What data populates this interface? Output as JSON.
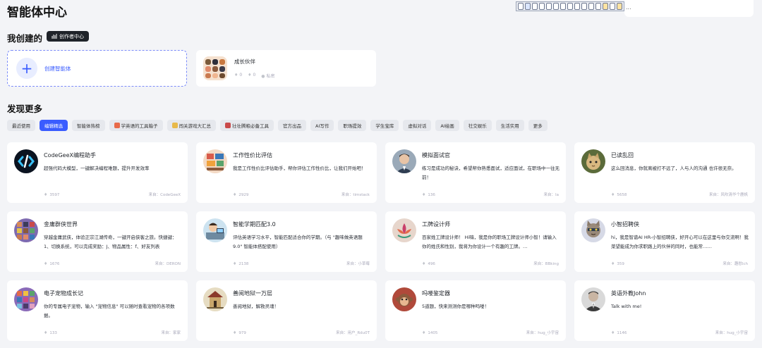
{
  "page_title": "智能体中心",
  "toolbar_ellipsis": "...",
  "created_section": {
    "title": "我创建的",
    "creator_badge": "创作者中心",
    "create_label": "创建智能体",
    "my_agent": {
      "name": "成长伙伴",
      "likes": "0",
      "favorites": "0",
      "status": "私密"
    }
  },
  "discover_section": {
    "title": "发现更多",
    "tabs": [
      {
        "label": "最近使用",
        "active": false,
        "emoji_color": ""
      },
      {
        "label": "编辑精选",
        "active": true,
        "emoji_color": ""
      },
      {
        "label": "智能体热榜",
        "active": false,
        "emoji_color": ""
      },
      {
        "label": "学英语的工具箱子",
        "active": false,
        "emoji_color": "#e86a4a"
      },
      {
        "label": "闯关游戏大汇总",
        "active": false,
        "emoji_color": "#e8b94a"
      },
      {
        "label": "壮壮腾粮必备工具",
        "active": false,
        "emoji_color": "#c94a4a"
      },
      {
        "label": "官方出品",
        "active": false,
        "emoji_color": ""
      },
      {
        "label": "AI写作",
        "active": false,
        "emoji_color": ""
      },
      {
        "label": "职场提效",
        "active": false,
        "emoji_color": ""
      },
      {
        "label": "学生宝库",
        "active": false,
        "emoji_color": ""
      },
      {
        "label": "虚拟对话",
        "active": false,
        "emoji_color": ""
      },
      {
        "label": "AI绘画",
        "active": false,
        "emoji_color": ""
      },
      {
        "label": "社交娱乐",
        "active": false,
        "emoji_color": ""
      },
      {
        "label": "生活实用",
        "active": false,
        "emoji_color": ""
      },
      {
        "label": "更多",
        "active": false,
        "emoji_color": ""
      }
    ],
    "cards": [
      {
        "title": "CodeGeeX编程助手",
        "desc": "超强代码大模型，一键解决编程难题，提升开发效率",
        "uses": "3597",
        "author": "来自：CodeGeeX",
        "avatar_icon": "code-logo"
      },
      {
        "title": "工作性价比评估",
        "desc": "我是工作性价比评估助手，帮你评估工作性价比，让我们开始吧！",
        "uses": "2929",
        "author": "来自：timstack",
        "avatar_icon": "office-illustration"
      },
      {
        "title": "模拟面试官",
        "desc": "练习是成功的秘诀，希望帮你熟悉面试，适应面试，在职场中一往无前！",
        "uses": "136",
        "author": "来自：Ia",
        "avatar_icon": "man-portrait"
      },
      {
        "title": "已读乱回",
        "desc": "这么回消息，你就离被打不远了，人与人的沟通 也许很无奈。",
        "uses": "5658",
        "author": "来自：风吹清华个鹿帆",
        "avatar_icon": "cat-photo"
      },
      {
        "title": "金庸群侠世界",
        "desc": "穿越金庸武侠，体验正宗江湖传奇，一键开启侠客之旅。快捷键：1、切换系统，可以完成奖励：J、物品属性：f、好友列表",
        "uses": "1676",
        "author": "来自：DERON",
        "avatar_icon": "pixel-characters"
      },
      {
        "title": "智能学期匹配3.0",
        "desc": "评估英语学习水平，智能匹配适合你的学期。（与 \"趣味做英语题9.0\" 智能体搭配使用）",
        "uses": "2138",
        "author": "来自：小草莓",
        "avatar_icon": "student-illustration"
      },
      {
        "title": "工牌设计师",
        "desc": "百家姓工牌设计师！ Hi嗨，我是你的职场工牌设计师小智！请输入你的姓氏和性别，我将为你设计一个有趣的工牌。…",
        "uses": "496",
        "author": "来自：BBking",
        "avatar_icon": "lotus-emblem"
      },
      {
        "title": "小智招聘侠",
        "desc": "hi，我是智谱AI HR-小智招聘侠，好开心可以在这里与你交流啊！我菜望能成为你求职路上的伙伴的同时，也能常……",
        "uses": "359",
        "author": "来自：趣慰Ich",
        "avatar_icon": "cat-hero"
      },
      {
        "title": "电子宠物成长记",
        "desc": "你的专属电子宠物，输入 \"宠物信息\" 可以随时查看宠物的各项数据。",
        "uses": "133",
        "author": "来自：家家",
        "avatar_icon": "pixel-pets"
      },
      {
        "title": "善阅地狱一万层",
        "desc": "善阅地狱，解救灵魂！",
        "uses": "979",
        "author": "来自：用户_Rdu0T",
        "avatar_icon": "temple-illustration"
      },
      {
        "title": "吗喽鉴定器",
        "desc": "5道题，快来测测你是哪种吗喽！",
        "uses": "1405",
        "author": "来自：hug_小宇宙",
        "avatar_icon": "monkey-photo"
      },
      {
        "title": "英语外教John",
        "desc": "Talk with me!",
        "uses": "1146",
        "author": "来自：hug_小宇宙",
        "avatar_icon": "john-portrait"
      }
    ]
  },
  "colors": {
    "accent": "#3a5cff",
    "badge_bg": "#1f2329",
    "tab_bg": "#e6e8ed"
  }
}
